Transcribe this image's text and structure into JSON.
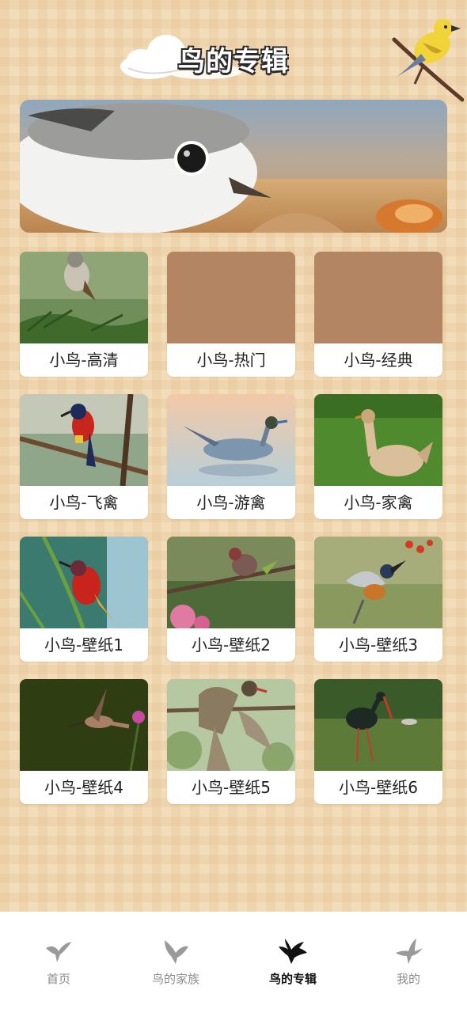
{
  "header": {
    "title": "鸟的专辑",
    "decor": [
      "cloud-icon",
      "yellow-bird-icon"
    ]
  },
  "banner": {
    "subject": "plover-chick-photo"
  },
  "albums": [
    {
      "label": "小鸟-高清",
      "thumb": "sparrow-on-pine"
    },
    {
      "label": "小鸟-热门",
      "thumb": "placeholder"
    },
    {
      "label": "小鸟-经典",
      "thumb": "placeholder"
    },
    {
      "label": "小鸟-飞禽",
      "thumb": "sunbird-on-branch"
    },
    {
      "label": "小鸟-游禽",
      "thumb": "pintail-duck"
    },
    {
      "label": "小鸟-家禽",
      "thumb": "hen-on-grass"
    },
    {
      "label": "小鸟-壁纸1",
      "thumb": "red-sunbird"
    },
    {
      "label": "小鸟-壁纸2",
      "thumb": "finch-on-branch"
    },
    {
      "label": "小鸟-壁纸3",
      "thumb": "kingfisher-flying"
    },
    {
      "label": "小鸟-壁纸4",
      "thumb": "hummingbird"
    },
    {
      "label": "小鸟-壁纸5",
      "thumb": "hawk-cuckoo"
    },
    {
      "label": "小鸟-壁纸6",
      "thumb": "stork-in-marsh"
    }
  ],
  "tabbar": {
    "tabs": [
      {
        "label": "首页",
        "icon": "bird-icon",
        "active": false
      },
      {
        "label": "鸟的家族",
        "icon": "bird-icon",
        "active": false
      },
      {
        "label": "鸟的专辑",
        "icon": "bird-icon",
        "active": true
      },
      {
        "label": "我的",
        "icon": "bird-icon",
        "active": false
      }
    ]
  },
  "colors": {
    "background": "#f3dcb9",
    "placeholder": "#b48563",
    "active_tab": "#111111",
    "inactive_tab": "#8c8c8c"
  }
}
